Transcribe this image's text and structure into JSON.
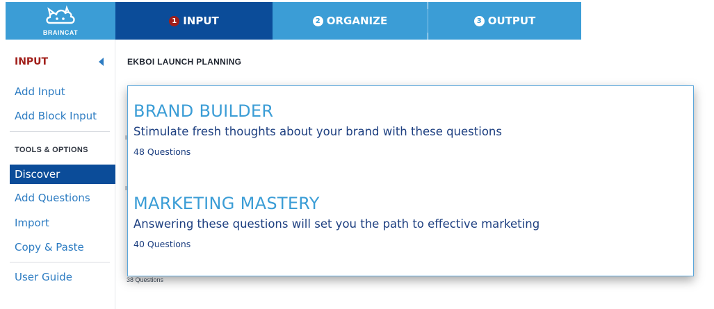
{
  "logo": {
    "text": "BRAINCAT",
    "icon": "cat-cloud-icon"
  },
  "steps": [
    {
      "number": "1",
      "label": "INPUT",
      "active": true
    },
    {
      "number": "2",
      "label": "ORGANIZE",
      "active": false
    },
    {
      "number": "3",
      "label": "OUTPUT",
      "active": false
    }
  ],
  "sidebar": {
    "header": "INPUT",
    "input_items": [
      "Add Input",
      "Add Block Input"
    ],
    "section_title": "TOOLS & OPTIONS",
    "tool_items": [
      "Discover",
      "Add Questions",
      "Import",
      "Copy & Paste"
    ],
    "footer_item": "User Guide"
  },
  "main": {
    "project_title": "EKBOI LAUNCH PLANNING",
    "background_count": "38 Questions"
  },
  "popup": {
    "cards": [
      {
        "title": "BRAND BUILDER",
        "description": "Stimulate fresh thoughts about your brand with these questions",
        "count": "48 Questions"
      },
      {
        "title": "MARKETING MASTERY",
        "description": "Answering these questions will set you the path to effective marketing",
        "count": "40 Questions"
      }
    ]
  },
  "colors": {
    "brand_blue": "#3b9dd6",
    "active_navy": "#0b4c99",
    "accent_red": "#a11f1a",
    "link_blue": "#2d7cc2"
  }
}
